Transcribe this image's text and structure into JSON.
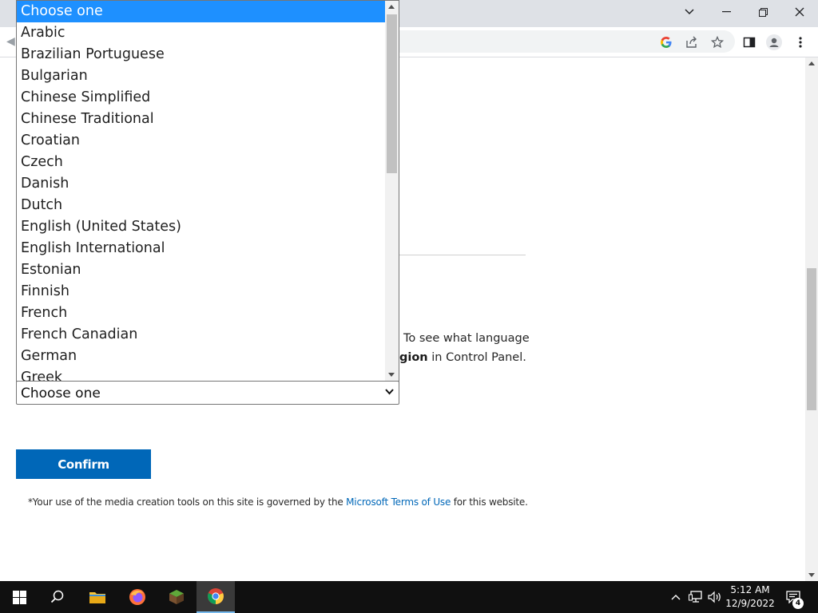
{
  "dropdown": {
    "selected_index": 0,
    "options": [
      "Choose one",
      "Arabic",
      "Brazilian Portuguese",
      "Bulgarian",
      "Chinese Simplified",
      "Chinese Traditional",
      "Croatian",
      "Czech",
      "Danish",
      "Dutch",
      "English (United States)",
      "English International",
      "Estonian",
      "Finnish",
      "French",
      "French Canadian",
      "German",
      "Greek"
    ]
  },
  "select": {
    "value": "Choose one"
  },
  "paragraph": {
    "line1": "To see what language",
    "line2_bold": "gion",
    "line2_rest": " in Control Panel."
  },
  "confirm_label": "Confirm",
  "terms": {
    "prefix": "*Your use of the media creation tools on this site is governed by the ",
    "link": "Microsoft Terms of Use",
    "suffix": " for this website."
  },
  "clock": {
    "time": "5:12 AM",
    "date": "12/9/2022"
  },
  "notification_count": "4",
  "colors": {
    "accent": "#0067b8",
    "selection": "#1e90ff"
  },
  "icons": {
    "toolbar": [
      "google-icon",
      "share-icon",
      "star-icon",
      "side-panel-icon",
      "profile-icon",
      "menu-icon"
    ],
    "taskbar": [
      "windows-start-icon",
      "search-icon",
      "file-explorer-icon",
      "firefox-icon",
      "minecraft-icon",
      "chrome-icon"
    ]
  }
}
